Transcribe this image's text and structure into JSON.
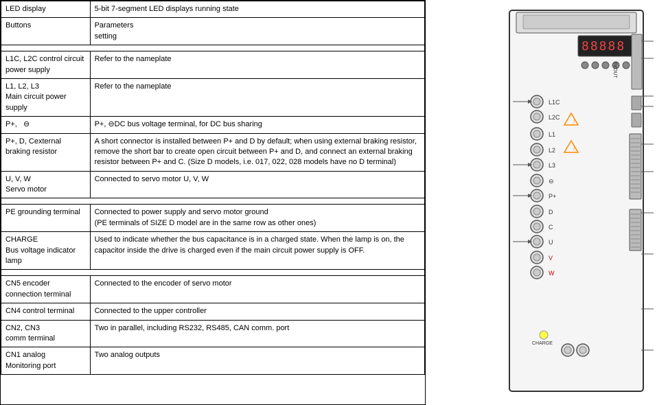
{
  "table": {
    "rows": [
      {
        "label": "LED display",
        "description": "5-bit 7-segment LED displays running state",
        "separator_after": false
      },
      {
        "label": "Buttons",
        "description": "Parameters\nsetting",
        "separator_after": true
      },
      {
        "label": "L1C, L2C control circuit power supply",
        "description": "Refer to the nameplate",
        "separator_after": false
      },
      {
        "label": "L1, L2, L3\nMain circuit power supply",
        "description": "Refer to the nameplate",
        "separator_after": false
      },
      {
        "label": "P+,    ⊖",
        "description": "P+, ⊖DC bus voltage terminal, for DC bus sharing",
        "separator_after": false
      },
      {
        "label": "P+, D, Cexternal braking resistor",
        "description": "A short connector is installed between P+ and D by default; when using external braking resistor, remove the short bar to create open circuit between P+ and D, and connect an external braking resistor between P+ and C. (Size D models, i.e. 017, 022, 028 models have no D terminal)",
        "separator_after": false
      },
      {
        "label": "U, V, W\nServo motor",
        "description": "Connected to servo motor U, V, W",
        "separator_after": true
      },
      {
        "label": "PE grounding terminal",
        "description": "Connected to power supply and servo motor ground\n(PE terminals of SIZE D model are in the same row as other ones)",
        "separator_after": false
      },
      {
        "label": "CHARGE\nBus voltage indicator lamp",
        "description": "Used to indicate whether the bus capacitance is in a charged state. When the lamp is on, the capacitor inside the drive is charged even if the main circuit power supply is OFF.",
        "separator_after": true
      },
      {
        "label": "CN5 encoder connection terminal",
        "description": "Connected to the encoder of servo motor",
        "separator_after": false
      },
      {
        "label": "CN4 control terminal",
        "description": "Connected to the upper controller",
        "separator_after": false
      },
      {
        "label": "CN2, CN3\ncomm terminal",
        "description": "Two in parallel, including RS232, RS485, CAN comm. port",
        "separator_after": false
      },
      {
        "label": "CN1 analog\nMonitoring port",
        "description": "Two analog outputs",
        "separator_after": false
      }
    ]
  }
}
